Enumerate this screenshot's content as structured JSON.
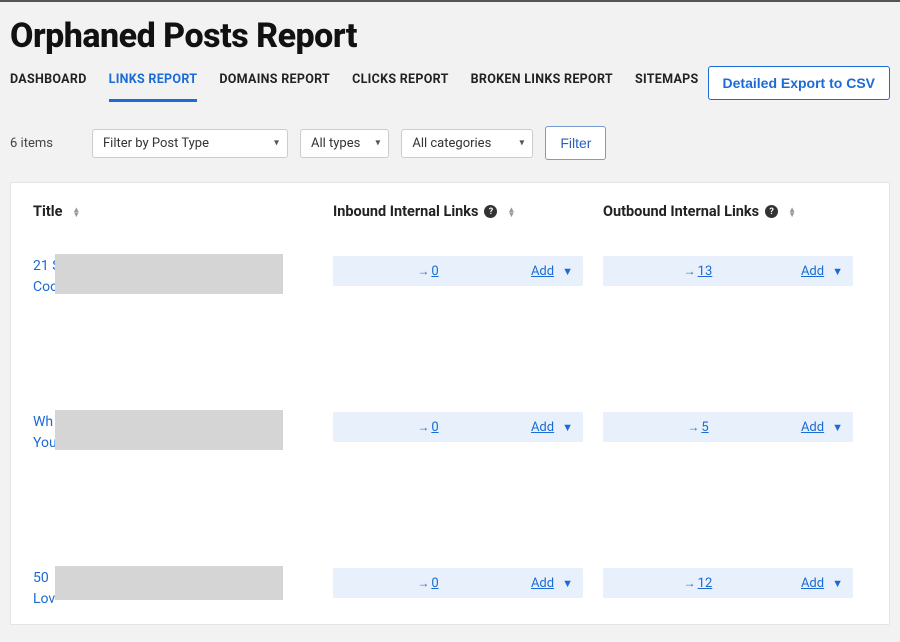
{
  "page_title": "Orphaned Posts Report",
  "tabs": [
    {
      "label": "DASHBOARD"
    },
    {
      "label": "LINKS REPORT"
    },
    {
      "label": "DOMAINS REPORT"
    },
    {
      "label": "CLICKS REPORT"
    },
    {
      "label": "BROKEN LINKS REPORT"
    },
    {
      "label": "SITEMAPS"
    }
  ],
  "active_tab_index": 1,
  "export_label": "Detailed Export to CSV",
  "items_count_text": "6 items",
  "filters": {
    "post_type_placeholder": "Filter by Post Type",
    "types_placeholder": "All types",
    "categories_placeholder": "All categories",
    "filter_button": "Filter"
  },
  "columns": {
    "title": "Title",
    "inbound": "Inbound Internal Links",
    "outbound": "Outbound Internal Links"
  },
  "add_label": "Add",
  "rows": [
    {
      "title_line1": "21 S",
      "title_line2": "Coo",
      "inbound": "0",
      "outbound": "13"
    },
    {
      "title_line1": "Wh",
      "title_line2": "You",
      "inbound": "0",
      "outbound": "5"
    },
    {
      "title_line1": "50",
      "title_line2": "Lov",
      "inbound": "0",
      "outbound": "12"
    }
  ]
}
